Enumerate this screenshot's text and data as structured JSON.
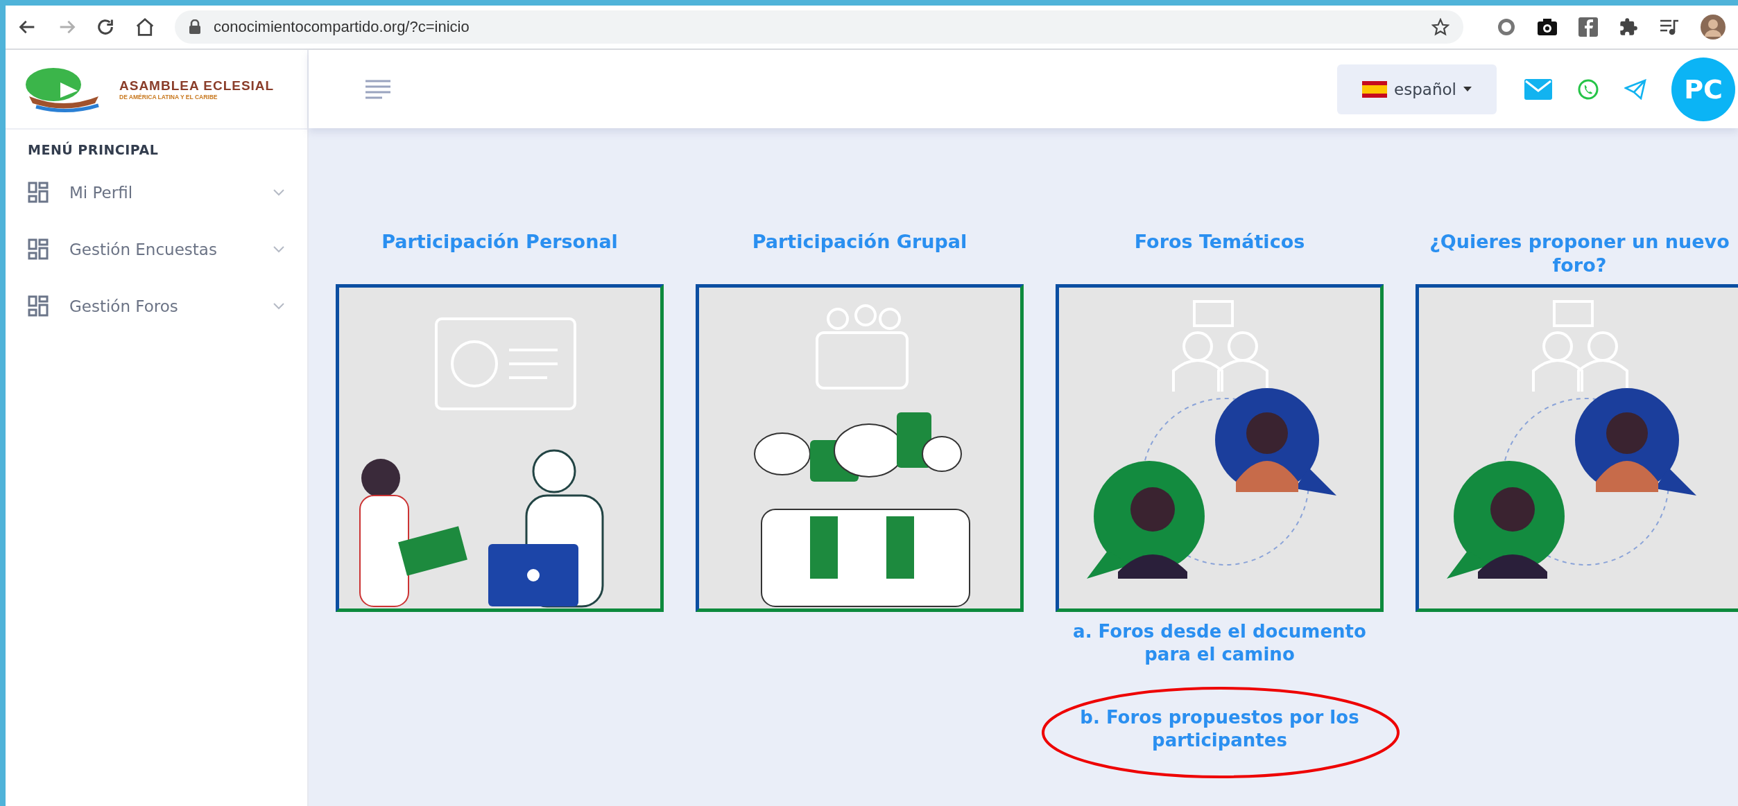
{
  "browser": {
    "url": "conocimientocompartido.org/?c=inicio"
  },
  "header": {
    "logo": {
      "title": "ASAMBLEA ECLESIAL",
      "subtitle": "DE AMÉRICA LATINA Y EL CARIBE"
    },
    "language": "español",
    "avatar": "PC"
  },
  "sidebar": {
    "heading": "MENÚ PRINCIPAL",
    "items": [
      {
        "label": "Mi Perfil"
      },
      {
        "label": "Gestión Encuestas"
      },
      {
        "label": "Gestión Foros"
      }
    ]
  },
  "cards": [
    {
      "title": "Participación Personal",
      "kind": "personal"
    },
    {
      "title": "Participación Grupal",
      "kind": "group"
    },
    {
      "title": "Foros Temáticos",
      "kind": "forum",
      "links": [
        {
          "label": "a. Foros desde el documento para el camino",
          "highlighted": false
        },
        {
          "label": "b. Foros propuestos por los participantes",
          "highlighted": true
        }
      ]
    },
    {
      "title": "¿Quieres proponer un nuevo foro?",
      "kind": "forum"
    }
  ]
}
